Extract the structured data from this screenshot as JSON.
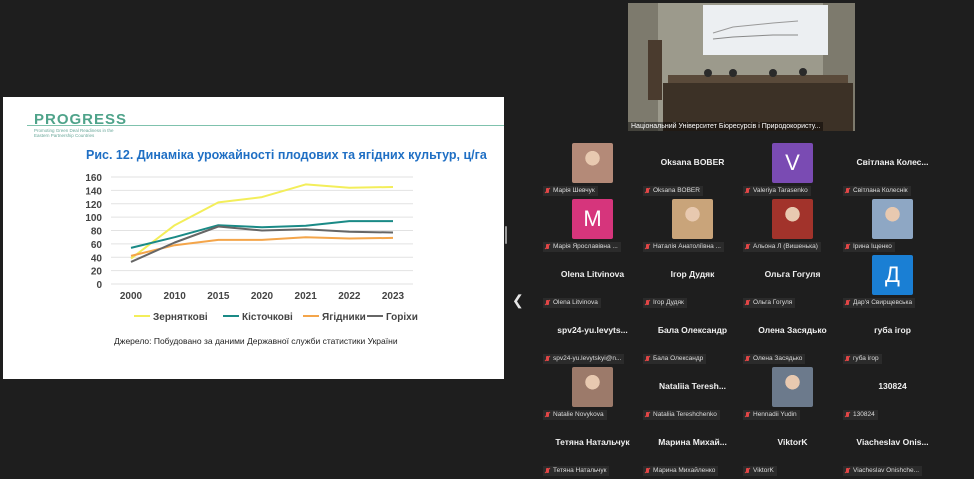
{
  "slide": {
    "logo": "PROGRESS",
    "logo_subtitle": "Promoting Green Deal Readiness in the Eastern Partnership Countries",
    "title": "Рис. 12. Динаміка урожайності плодових та ягідних культур, ц/га",
    "source": "Джерело: Побудовано за даними Державної служби статистики України"
  },
  "chart_data": {
    "type": "line",
    "title": "Рис. 12. Динаміка урожайності плодових та ягідних культур, ц/га",
    "categories": [
      "2000",
      "2010",
      "2015",
      "2020",
      "2021",
      "2022",
      "2023"
    ],
    "ylim": [
      0,
      160
    ],
    "yticks": [
      0,
      20,
      40,
      60,
      80,
      100,
      120,
      140,
      160
    ],
    "grid": true,
    "legend": "bottom",
    "series": [
      {
        "name": "Зерняткові",
        "color": "#f3ee5a",
        "values": [
          38,
          88,
          122,
          130,
          149,
          144,
          145
        ]
      },
      {
        "name": "Кісточкові",
        "color": "#1a8a86",
        "values": [
          54,
          70,
          88,
          85,
          87,
          94,
          94
        ]
      },
      {
        "name": "Ягідники",
        "color": "#f4a54a",
        "values": [
          42,
          58,
          66,
          66,
          70,
          68,
          69
        ]
      },
      {
        "name": "Горіхи",
        "color": "#666666",
        "values": [
          33,
          62,
          86,
          80,
          82,
          78,
          77
        ]
      }
    ]
  },
  "video": {
    "caption": "Національний Університет Біоресурсів і Природокористу..."
  },
  "participants": [
    {
      "name": "",
      "label": "Марія Шевчук",
      "avatar": "photo",
      "avatar_color": "#b48a78"
    },
    {
      "name": "Oksana BOBER",
      "label": "Oksana BOBER",
      "avatar": "none"
    },
    {
      "name": "",
      "label": "Valeriya Tarasenko",
      "avatar": "letter",
      "letter": "V",
      "avatar_color": "#7a4bb3"
    },
    {
      "name": "Світлана Колес...",
      "label": "Світлана Колеснік",
      "avatar": "none"
    },
    {
      "name": "",
      "label": "Марія Ярославівна ...",
      "avatar": "letter",
      "letter": "M",
      "avatar_color": "#d6357c"
    },
    {
      "name": "",
      "label": "Наталія Анатоліївна ...",
      "avatar": "photo",
      "avatar_color": "#c9a47a"
    },
    {
      "name": "",
      "label": "Альона Л (Вишенька)",
      "avatar": "photo",
      "avatar_color": "#a2332b"
    },
    {
      "name": "",
      "label": "Ірина Іщенко",
      "avatar": "photo",
      "avatar_color": "#8ea7c4"
    },
    {
      "name": "Olena Litvinova",
      "label": "Olena Litvinova",
      "avatar": "none"
    },
    {
      "name": "Ігор Дудяк",
      "label": "Ігор Дудяк",
      "avatar": "none"
    },
    {
      "name": "Ольга Гогуля",
      "label": "Ольга Гогуля",
      "avatar": "none"
    },
    {
      "name": "",
      "label": "Дар'я Свирщевська",
      "avatar": "letter",
      "letter": "Д",
      "avatar_color": "#1a7fd4"
    },
    {
      "name": "spv24-yu.levyts...",
      "label": "spv24-yu.levytskyi@n...",
      "avatar": "none"
    },
    {
      "name": "Бала Олександр",
      "label": "Бала Олександр",
      "avatar": "none"
    },
    {
      "name": "Олена Засядько",
      "label": "Олена Засядько",
      "avatar": "none"
    },
    {
      "name": "губа ігор",
      "label": "губа ігор",
      "avatar": "none"
    },
    {
      "name": "",
      "label": "Natalie Novykova",
      "avatar": "photo",
      "avatar_color": "#9c7a6a"
    },
    {
      "name": "Nataliia Teresh...",
      "label": "Nataliia Tereshchenko",
      "avatar": "none"
    },
    {
      "name": "",
      "label": "Hennadii Yudin",
      "avatar": "photo",
      "avatar_color": "#6c7a8c"
    },
    {
      "name": "130824",
      "label": "130824",
      "avatar": "none"
    },
    {
      "name": "Тетяна Натальчук",
      "label": "Тетяна Натальчук",
      "avatar": "none"
    },
    {
      "name": "Марина Михай...",
      "label": "Марина Михайленко",
      "avatar": "none"
    },
    {
      "name": "ViktorK",
      "label": "ViktorK",
      "avatar": "none"
    },
    {
      "name": "Viacheslav Onis...",
      "label": "Viacheslav Onishche...",
      "avatar": "none"
    }
  ]
}
